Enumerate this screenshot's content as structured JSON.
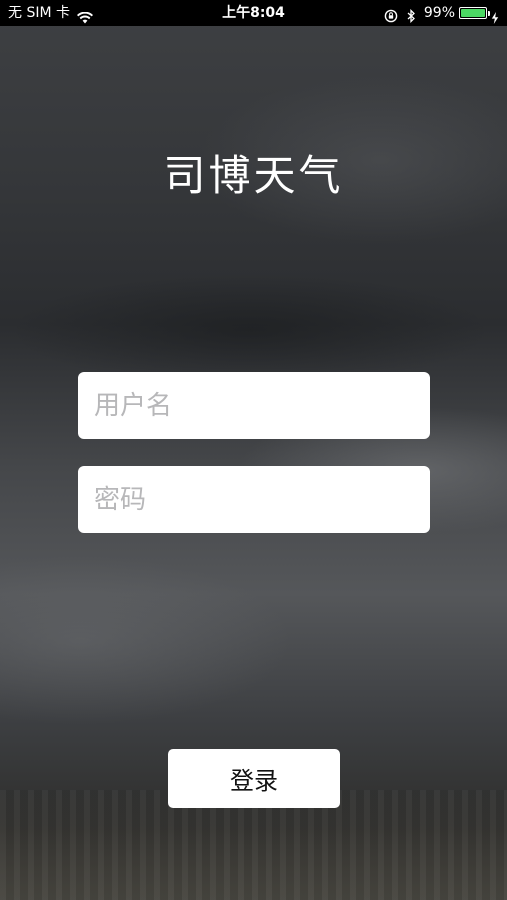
{
  "status_bar": {
    "carrier": "无 SIM 卡",
    "time": "上午8:04",
    "battery_percent": "99%",
    "battery_level": 0.99,
    "icons": [
      "wifi-icon",
      "lock-rotation-icon",
      "bluetooth-icon",
      "battery-icon",
      "charging-icon"
    ]
  },
  "app": {
    "title": "司博天气"
  },
  "login_form": {
    "username_placeholder": "用户名",
    "password_placeholder": "密码",
    "login_label": "登录"
  },
  "colors": {
    "battery_fill": "#4cd964",
    "button_background": "#ffffff",
    "input_background": "#ffffff",
    "title_text": "#ffffff"
  }
}
